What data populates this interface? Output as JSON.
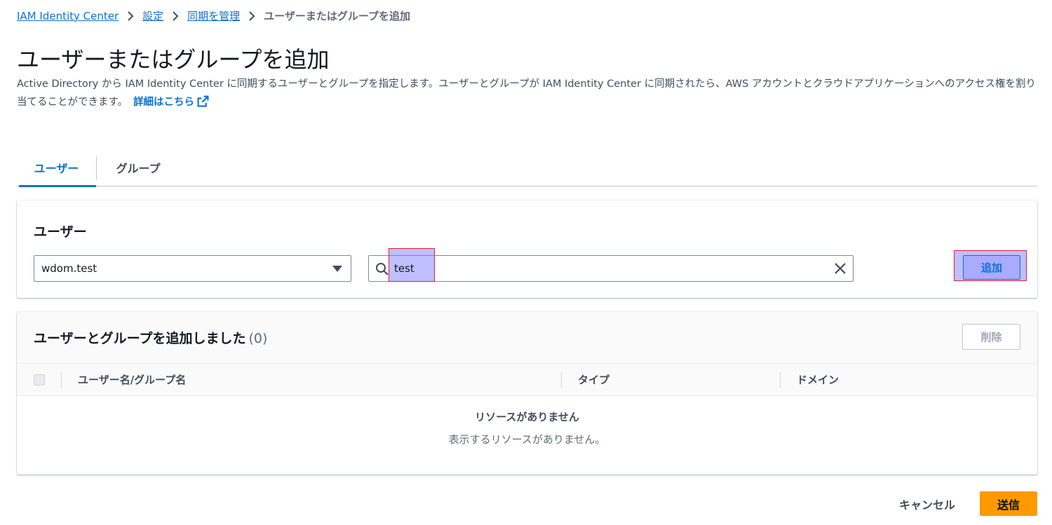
{
  "breadcrumb": {
    "items": [
      "IAM Identity Center",
      "設定",
      "同期を管理"
    ],
    "current": "ユーザーまたはグループを追加"
  },
  "page": {
    "title": "ユーザーまたはグループを追加",
    "description": "Active Directory から IAM Identity Center に同期するユーザーとグループを指定します。ユーザーとグループが IAM Identity Center に同期されたら、AWS アカウントとクラウドアプリケーションへのアクセス権を割り当てることができます。",
    "learn_more": "詳細はこちら"
  },
  "tabs": [
    {
      "label": "ユーザー",
      "active": true
    },
    {
      "label": "グループ",
      "active": false
    }
  ],
  "users_panel": {
    "title": "ユーザー",
    "domain_value": "wdom.test",
    "search_value": "test",
    "add_button": "追加"
  },
  "added_panel": {
    "title": "ユーザーとグループを追加しました",
    "count": "(0)",
    "remove_button": "削除",
    "columns": [
      "ユーザー名/グループ名",
      "タイプ",
      "ドメイン"
    ],
    "empty_title": "リソースがありません",
    "empty_description": "表示するリソースがありません。"
  },
  "footer": {
    "cancel": "キャンセル",
    "submit": "送信"
  },
  "colors": {
    "link": "#0972d3",
    "primary_button": "#ff9900"
  }
}
